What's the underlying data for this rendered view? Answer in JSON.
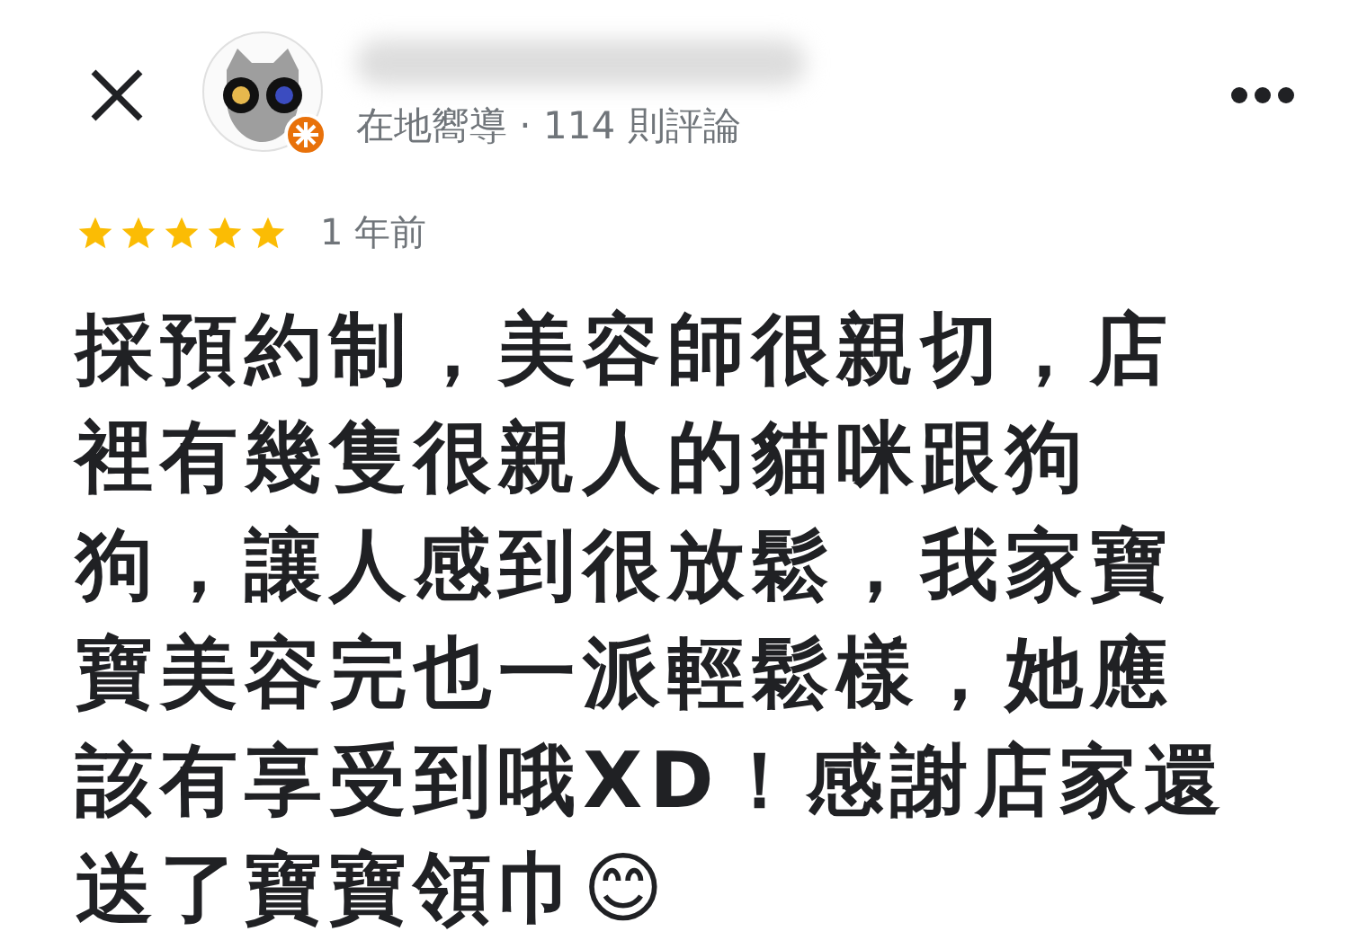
{
  "header": {
    "subtitle": "在地嚮導 · 114 則評論"
  },
  "review": {
    "stars": 5,
    "time": "1 年前",
    "text": "採預約制，美容師很親切，店裡有幾隻很親人的貓咪跟狗狗，讓人感到很放鬆，我家寶寶美容完也一派輕鬆樣，她應該有享受到哦XD！感謝店家還送了寶寶領巾😊"
  }
}
